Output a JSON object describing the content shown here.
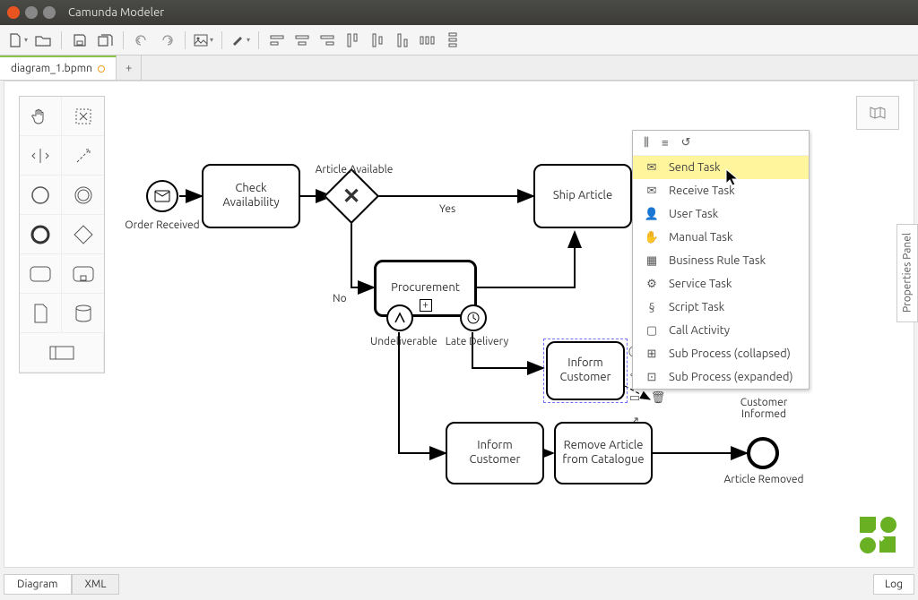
{
  "window": {
    "title": "Camunda Modeler"
  },
  "toolbar": {
    "new": "new",
    "open": "open",
    "save": "save",
    "saveall": "saveall",
    "undo": "undo",
    "redo": "redo",
    "image": "image",
    "paint": "paint",
    "align_left": "al",
    "align_center": "ac",
    "align_right": "ar",
    "align_top": "at",
    "align_mid": "am",
    "align_bot": "ab",
    "dist_h": "dh",
    "dist_v": "dv"
  },
  "tabs": {
    "file": "diagram_1.bpmn",
    "add": "+"
  },
  "palette": {
    "hand": "hand",
    "lasso": "lasso",
    "space": "space",
    "connect": "connect",
    "start": "start",
    "inter": "inter",
    "end": "end",
    "gateway": "gateway",
    "task": "task",
    "sub": "sub",
    "data": "data",
    "store": "store",
    "pool": "pool"
  },
  "minimap": {
    "label": "⊞"
  },
  "properties": {
    "label": "Properties Panel"
  },
  "bpmn": {
    "start_event": "Order Received",
    "check_avail": "Check Availability",
    "gw_avail_label": "Article Available",
    "yes": "Yes",
    "no": "No",
    "ship": "Ship Article",
    "procurement": "Procurement",
    "undeliverable": "Undeliverable",
    "late_delivery": "Late Delivery",
    "inform1": "Inform Customer",
    "inform2": "Inform Customer",
    "remove": "Remove Article from Catalogue",
    "customer_informed": "Customer Informed",
    "article_removed": "Article Removed"
  },
  "context_menu": {
    "items": [
      "Send Task",
      "Receive Task",
      "User Task",
      "Manual Task",
      "Business Rule Task",
      "Service Task",
      "Script Task",
      "Call Activity",
      "Sub Process (collapsed)",
      "Sub Process (expanded)"
    ]
  },
  "bottom": {
    "diagram": "Diagram",
    "xml": "XML",
    "log": "Log"
  }
}
